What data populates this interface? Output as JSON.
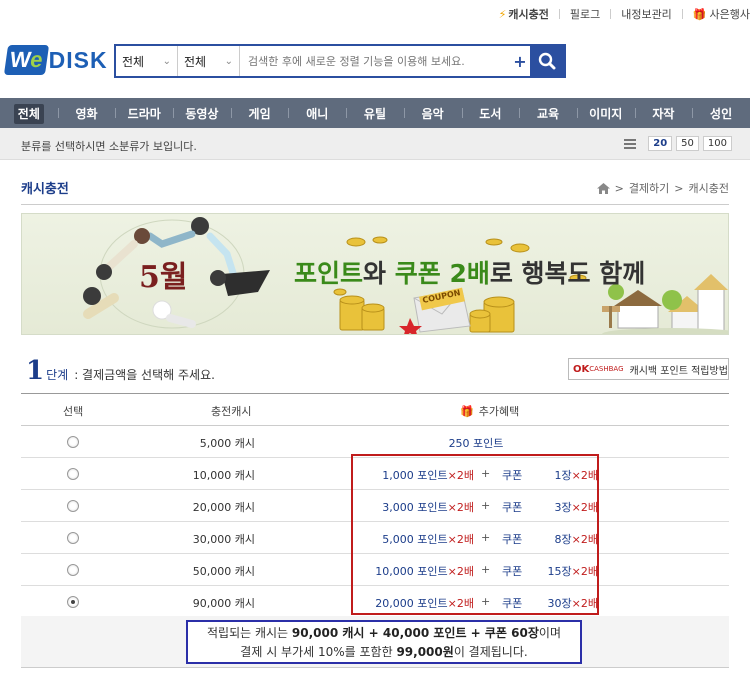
{
  "topbar": {
    "charge": "캐시충전",
    "links": [
      "필로그",
      "내정보관리"
    ],
    "event": "사은행사"
  },
  "logo": {
    "we": "We",
    "disk": "DISK"
  },
  "search": {
    "scope1": "전체",
    "scope2": "전체",
    "placeholder": "검색한 후에 새로운 정렬 기능을 이용해 보세요.",
    "plus": "+"
  },
  "nav": [
    "전체",
    "영화",
    "드라마",
    "동영상",
    "게임",
    "애니",
    "유틸",
    "음악",
    "도서",
    "교육",
    "이미지",
    "자작",
    "성인"
  ],
  "subbar": {
    "hint": "분류를 선택하시면 소분류가 보입니다.",
    "page_sizes": [
      "20",
      "50",
      "100"
    ]
  },
  "page": {
    "title": "캐시충전",
    "breadcrumb": [
      "결제하기",
      "캐시충전"
    ]
  },
  "banner": {
    "month": "5월",
    "slogan_part1": "포인트",
    "slogan_part2": "와 ",
    "slogan_part3": "쿠폰 2배",
    "slogan_part4": "로 행복도 함께",
    "coupon": "COUPON"
  },
  "step": {
    "num": "1",
    "label": "단계",
    "desc": ": 결제금액을 선택해 주세요."
  },
  "okcashbag": {
    "ok": "OK",
    "cashbag": "CASHBAG",
    "label": "캐시백 포인트 적립방법"
  },
  "table": {
    "headers": {
      "select": "선택",
      "amount": "충전캐시",
      "benefit": "추가혜택"
    },
    "rows": [
      {
        "amount": "5,000 캐시",
        "points": "250 포인트",
        "coupon": "",
        "selected": false
      },
      {
        "amount": "10,000 캐시",
        "points": "1,000 포인트",
        "coupon": "1장",
        "selected": false
      },
      {
        "amount": "20,000 캐시",
        "points": "3,000 포인트",
        "coupon": "3장",
        "selected": false
      },
      {
        "amount": "30,000 캐시",
        "points": "5,000 포인트",
        "coupon": "8장",
        "selected": false
      },
      {
        "amount": "50,000 캐시",
        "points": "10,000 포인트",
        "coupon": "15장",
        "selected": false
      },
      {
        "amount": "90,000 캐시",
        "points": "20,000 포인트",
        "coupon": "30장",
        "selected": true
      }
    ],
    "times2": "×2배",
    "plus": "+",
    "coupon_label": "쿠폰"
  },
  "summary": {
    "l1a": "적립되는 캐시는 ",
    "l1b": "90,000 캐시 + 40,000 포인트 + 쿠폰 60장",
    "l1c": "이며",
    "l2a": "결제 시 부가세 10%를 포함한 ",
    "l2b": "99,000원",
    "l2c": "이 결제됩니다."
  }
}
